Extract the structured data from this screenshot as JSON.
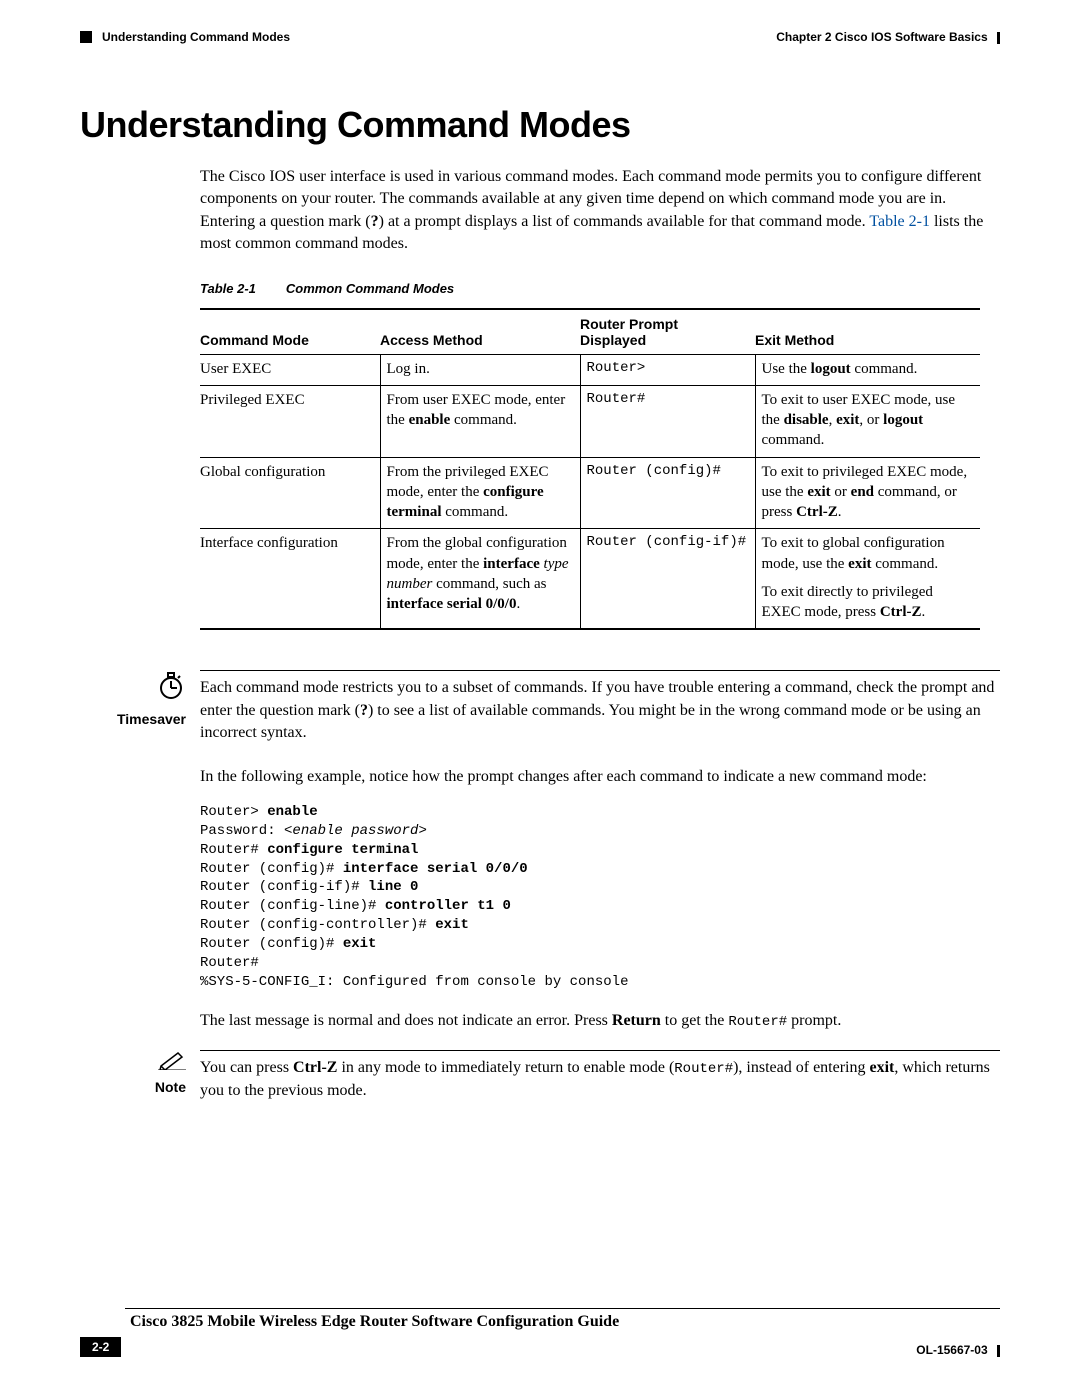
{
  "header": {
    "chapter": "Chapter 2      Cisco IOS Software Basics",
    "section": "Understanding Command Modes"
  },
  "heading": "Understanding Command Modes",
  "intro": {
    "p1a": "The Cisco IOS user interface is used in various command modes. Each command mode permits you to configure different components on your router. The commands available at any given time depend on which command mode you are in. Entering a question mark (",
    "p1b": "?",
    "p1c": ") at a prompt displays a list of commands available for that command mode. ",
    "link": "Table 2-1",
    "p1d": " lists the most common command modes."
  },
  "tableCaption": {
    "label": "Table 2-1",
    "title": "Common Command Modes"
  },
  "table": {
    "headers": [
      "Command Mode",
      "Access Method",
      "Router Prompt Displayed",
      "Exit Method"
    ],
    "rows": [
      {
        "mode": "User EXEC",
        "access": "Log in.",
        "prompt": "Router>",
        "exit": "Use the <b>logout</b> command."
      },
      {
        "mode": "Privileged EXEC",
        "access": "From user EXEC mode, enter the <b>enable</b> command.",
        "prompt": "Router#",
        "exit": "To exit to user EXEC mode, use the <b>disable</b>, <b>exit</b>, or <b>logout</b> command."
      },
      {
        "mode": "Global configuration",
        "access": "From the privileged EXEC mode, enter the <b>configure terminal</b> command.",
        "prompt": "Router (config)#",
        "exit": "To exit to privileged EXEC mode, use the <b>exit</b> or <b>end</b> command, or press <b>Ctrl-Z</b>."
      },
      {
        "mode": "Interface configuration",
        "access": "From the global configuration mode, enter the <b>interface</b> <i>type number</i> command, such as <b>interface serial 0/0/0</b>.",
        "prompt": "Router (config-if)#",
        "exit": "To exit to global configuration mode, use the <b>exit</b> command.",
        "exit2": "To exit directly to privileged EXEC mode, press <b>Ctrl-Z</b>."
      }
    ]
  },
  "timesaver": {
    "label": "Timesaver",
    "text_a": "Each command mode restricts you to a subset of commands. If you have trouble entering a command, check the prompt and enter the question mark (",
    "text_b": "?",
    "text_c": ") to see a list of available commands. You might be in the wrong command mode or be using an incorrect syntax."
  },
  "example_intro": "In the following example, notice how the prompt changes after each command to indicate a new command mode:",
  "code": [
    {
      "plain": "Router> ",
      "bold": "enable"
    },
    {
      "plain": "Password: ",
      "italic": "<enable password>"
    },
    {
      "plain": "Router# ",
      "bold": "configure terminal"
    },
    {
      "plain": "Router (config)# ",
      "bold": "interface serial 0/0/0"
    },
    {
      "plain": "Router (config-if)# ",
      "bold": "line 0"
    },
    {
      "plain": "Router (config-line)# ",
      "bold": "controller t1 0"
    },
    {
      "plain": "Router (config-controller)# ",
      "bold": "exit"
    },
    {
      "plain": "Router (config)# ",
      "bold": "exit"
    },
    {
      "plain": "Router#"
    },
    {
      "plain": "%SYS-5-CONFIG_I: Configured from console by console"
    }
  ],
  "last_msg": {
    "a": "The last message is normal and does not indicate an error. Press ",
    "b": "Return",
    "c": " to get the ",
    "d": "Router#",
    "e": " prompt."
  },
  "note": {
    "label": "Note",
    "a": "You can press ",
    "b": "Ctrl-Z",
    "c": " in any mode to immediately return to enable mode (",
    "d": "Router#",
    "e": "), instead of entering ",
    "f": "exit",
    "g": ", which returns you to the previous mode."
  },
  "footer": {
    "title": "Cisco 3825 Mobile Wireless Edge Router Software Configuration Guide",
    "page": "2-2",
    "docnum": "OL-15667-03"
  }
}
